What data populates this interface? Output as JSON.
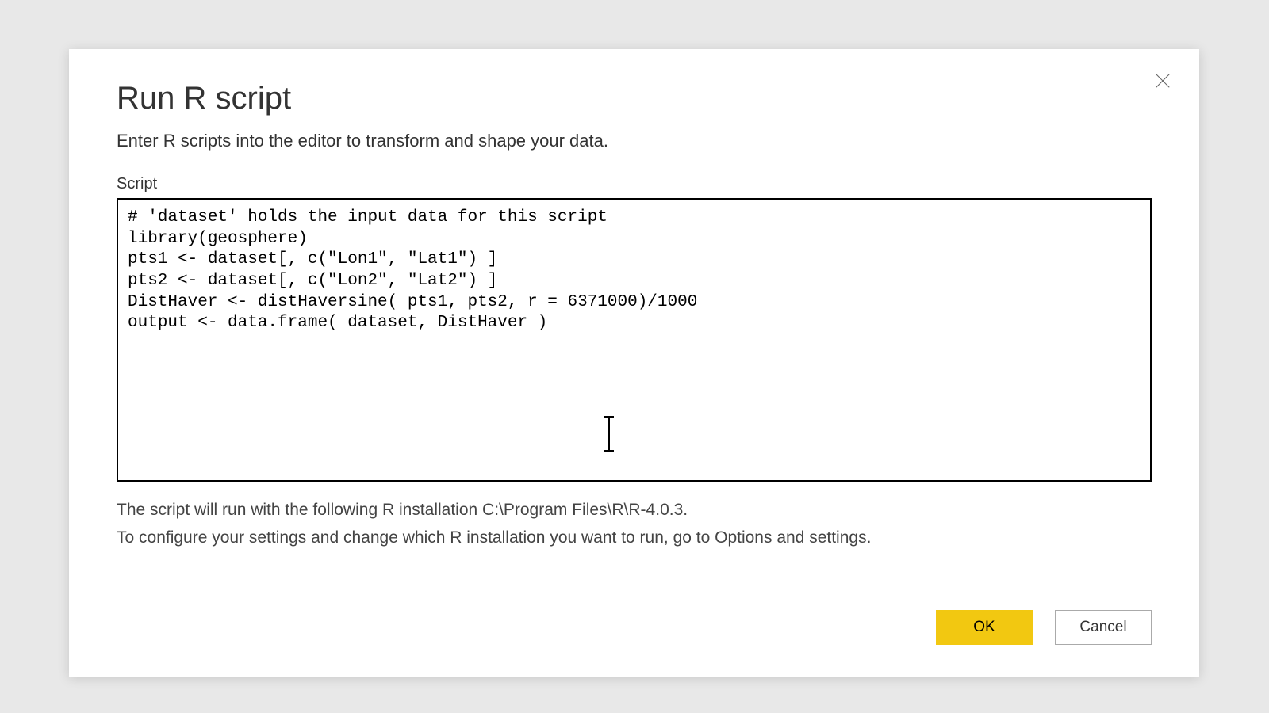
{
  "dialog": {
    "title": "Run R script",
    "description": "Enter R scripts into the editor to transform and shape your data.",
    "script_label": "Script",
    "script_value": "# 'dataset' holds the input data for this script\nlibrary(geosphere)\npts1 <- dataset[, c(\"Lon1\", \"Lat1\") ]\npts2 <- dataset[, c(\"Lon2\", \"Lat2\") ]\nDistHaver <- distHaversine( pts1, pts2, r = 6371000)/1000\noutput <- data.frame( dataset, DistHaver )",
    "footer_line1": "The script will run with the following R installation C:\\Program Files\\R\\R-4.0.3.",
    "footer_line2": "To configure your settings and change which R installation you want to run, go to Options and settings.",
    "buttons": {
      "ok": "OK",
      "cancel": "Cancel"
    }
  }
}
